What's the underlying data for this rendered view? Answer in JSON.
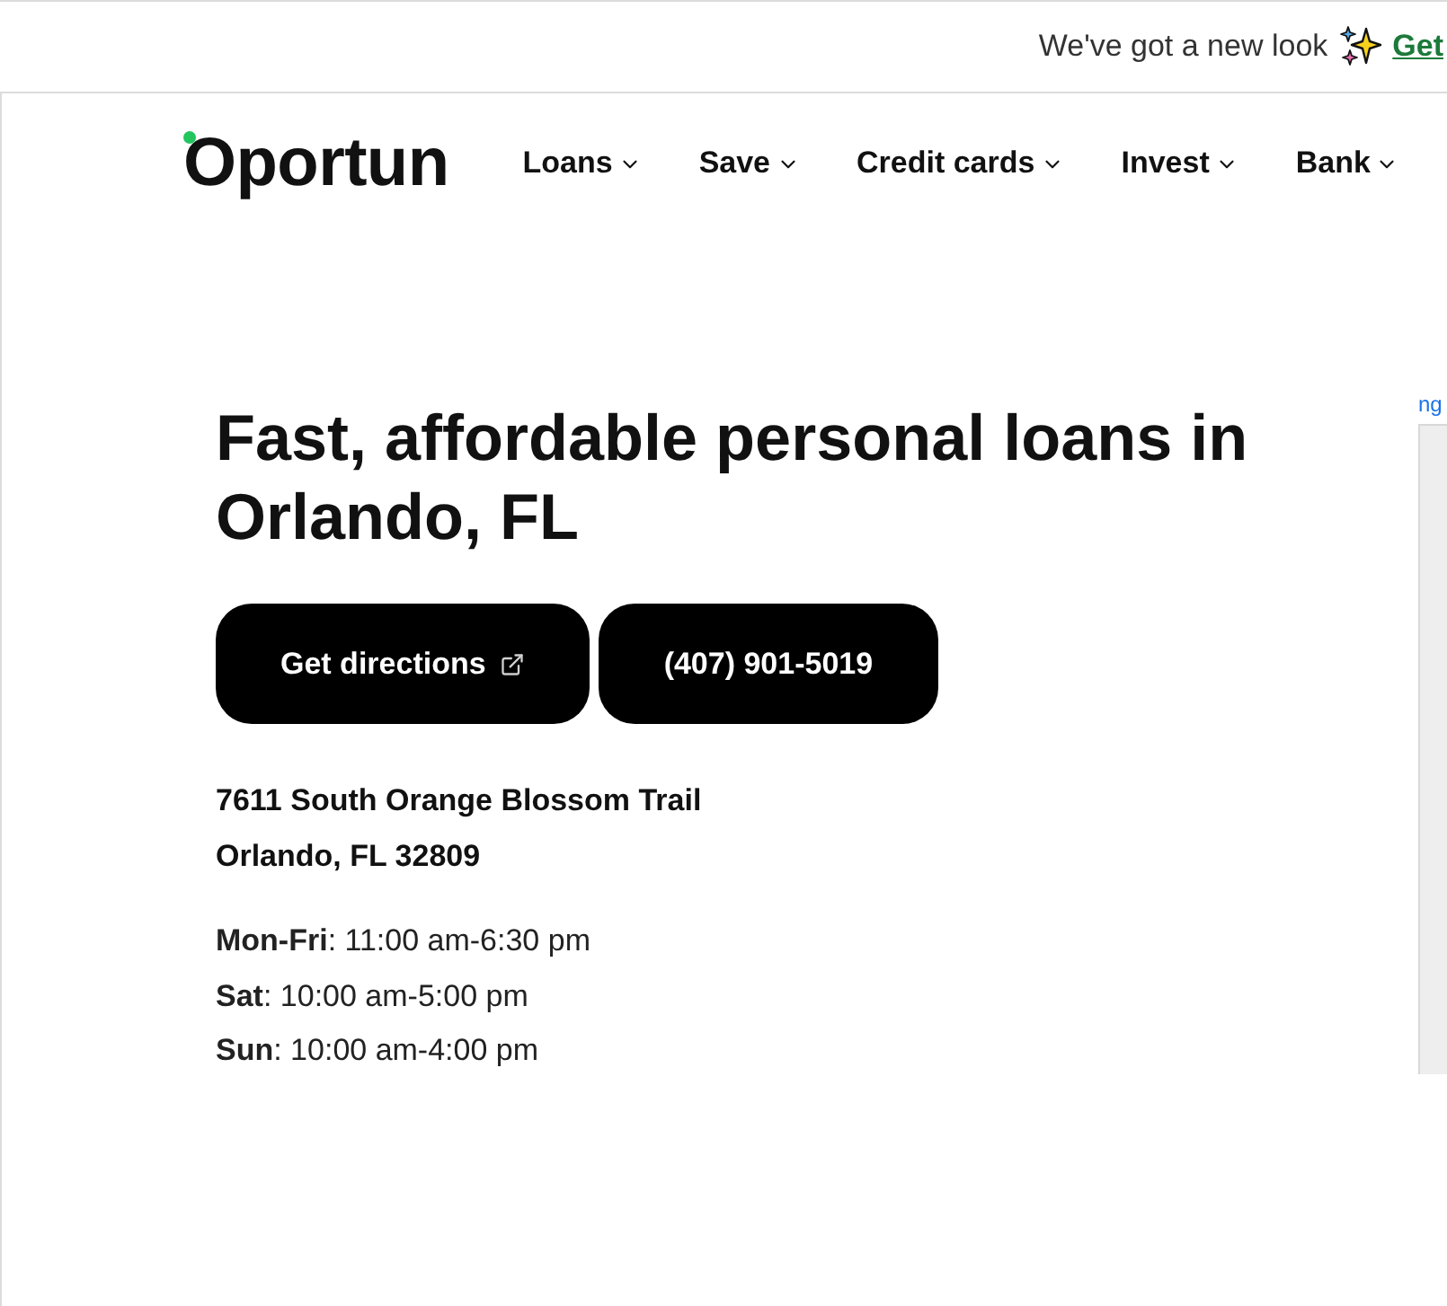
{
  "banner": {
    "text": "We've got a new look",
    "link": "Get"
  },
  "header": {
    "logo": "Oportun",
    "nav": [
      {
        "label": "Loans"
      },
      {
        "label": "Save"
      },
      {
        "label": "Credit cards"
      },
      {
        "label": "Invest"
      },
      {
        "label": "Bank"
      }
    ]
  },
  "hero": {
    "title": "Fast, affordable personal loans in Orlando, FL",
    "buttons": [
      {
        "label": "Get directions",
        "kind": "external"
      },
      {
        "label": "(407) 901-5019",
        "kind": "plain"
      }
    ],
    "address": [
      "7611 South Orange Blossom Trail",
      "Orlando, FL 32809"
    ],
    "hours": [
      "**Mon-Fri**: 11:00 am-6:30 pm",
      "**Sat**: 10:00 am-5:00 pm",
      "**Sun**: 10:00 am-4:00 pm"
    ]
  },
  "map": {
    "link": "ng"
  }
}
